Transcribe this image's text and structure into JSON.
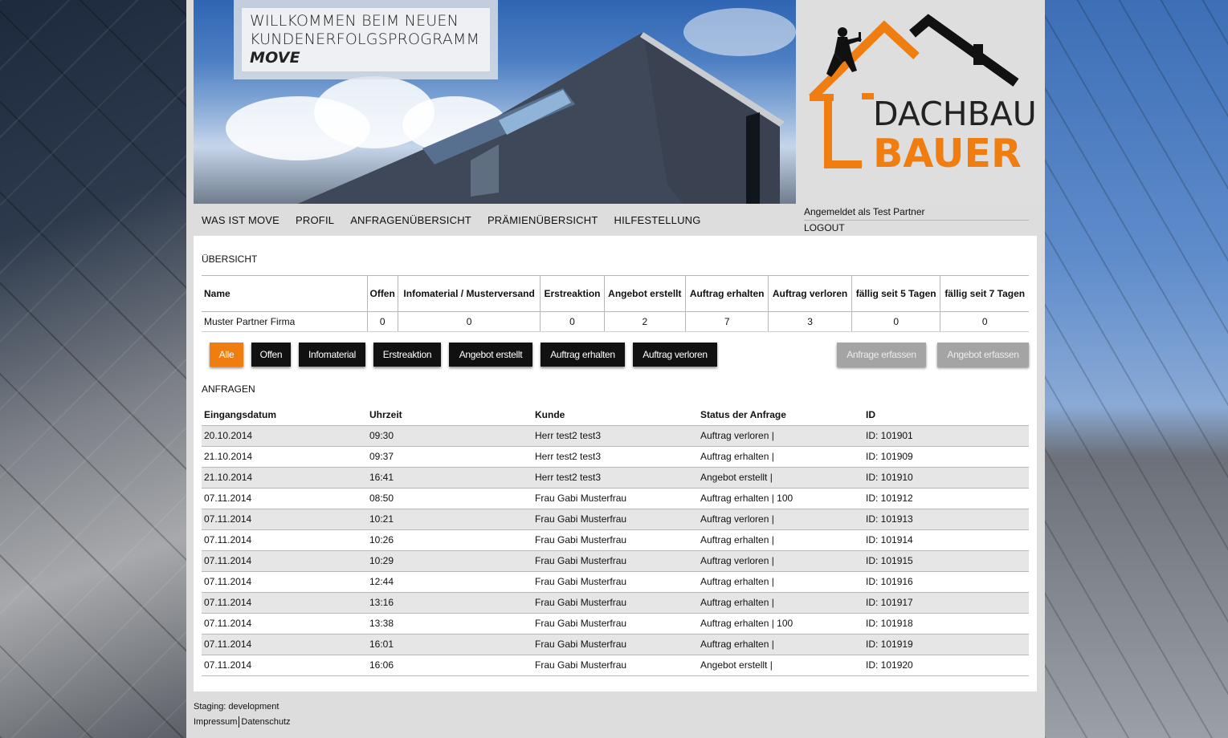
{
  "header": {
    "welcome_line1": "WILLKOMMEN BEIM NEUEN",
    "welcome_line2": "KUNDENERFOLGSPROGRAMM",
    "welcome_line3": "MOVE",
    "logo_line1": "DACHBAU",
    "logo_line2": "BAUER",
    "logo_accent": "#f07d10"
  },
  "nav": {
    "items": [
      "WAS IST MOVE",
      "PROFIL",
      "ANFRAGENÜBERSICHT",
      "PRÄMIENÜBERSICHT",
      "HILFESTELLUNG"
    ]
  },
  "user": {
    "logged_in_text": "Angemeldet als Test Partner",
    "logout_label": "LOGOUT"
  },
  "overview": {
    "title": "ÜBERSICHT",
    "columns": [
      "Name",
      "Offen",
      "Infomaterial / Musterversand",
      "Erstreaktion",
      "Angebot erstellt",
      "Auftrag erhalten",
      "Auftrag verloren",
      "fällig seit 5 Tagen",
      "fällig seit 7 Tagen"
    ],
    "row": [
      "Muster Partner Firma",
      "0",
      "0",
      "0",
      "2",
      "7",
      "3",
      "0",
      "0"
    ]
  },
  "filters": {
    "buttons": [
      "Alle",
      "Offen",
      "Infomaterial",
      "Erstreaktion",
      "Angebot erstellt",
      "Auftrag erhalten",
      "Auftrag verloren"
    ],
    "active": "Alle",
    "actions": [
      "Anfrage erfassen",
      "Angebot erfassen"
    ]
  },
  "requests": {
    "title": "ANFRAGEN",
    "columns": [
      "Eingangsdatum",
      "Uhrzeit",
      "Kunde",
      "Status der Anfrage",
      "ID"
    ],
    "rows": [
      [
        "20.10.2014",
        "09:30",
        "Herr test2 test3",
        "Auftrag verloren |",
        "ID: 101901"
      ],
      [
        "21.10.2014",
        "09:37",
        "Herr test2 test3",
        "Auftrag erhalten |",
        "ID: 101909"
      ],
      [
        "21.10.2014",
        "16:41",
        "Herr test2 test3",
        "Angebot erstellt |",
        "ID: 101910"
      ],
      [
        "07.11.2014",
        "08:50",
        "Frau Gabi Musterfrau",
        "Auftrag erhalten | 100",
        "ID: 101912"
      ],
      [
        "07.11.2014",
        "10:21",
        "Frau Gabi Musterfrau",
        "Auftrag verloren |",
        "ID: 101913"
      ],
      [
        "07.11.2014",
        "10:26",
        "Frau Gabi Musterfrau",
        "Auftrag erhalten |",
        "ID: 101914"
      ],
      [
        "07.11.2014",
        "10:29",
        "Frau Gabi Musterfrau",
        "Auftrag verloren |",
        "ID: 101915"
      ],
      [
        "07.11.2014",
        "12:44",
        "Frau Gabi Musterfrau",
        "Auftrag erhalten |",
        "ID: 101916"
      ],
      [
        "07.11.2014",
        "13:16",
        "Frau Gabi Musterfrau",
        "Auftrag erhalten |",
        "ID: 101917"
      ],
      [
        "07.11.2014",
        "13:38",
        "Frau Gabi Musterfrau",
        "Auftrag erhalten | 100",
        "ID: 101918"
      ],
      [
        "07.11.2014",
        "16:01",
        "Frau Gabi Musterfrau",
        "Auftrag erhalten |",
        "ID: 101919"
      ],
      [
        "07.11.2014",
        "16:06",
        "Frau Gabi Musterfrau",
        "Angebot erstellt |",
        "ID: 101920"
      ]
    ]
  },
  "footer": {
    "staging": "Staging: development",
    "impressum": "Impressum",
    "datenschutz": "Datenschutz"
  }
}
